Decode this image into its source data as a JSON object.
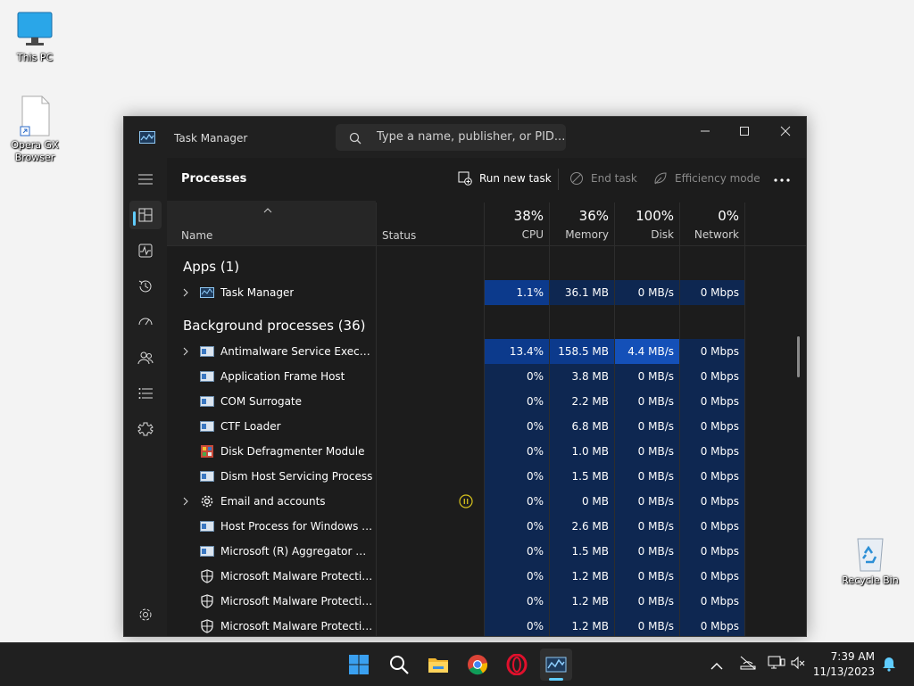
{
  "desktop": {
    "icons": [
      {
        "label": "This PC"
      },
      {
        "label": "Opera GX Browser"
      },
      {
        "label": "Recycle Bin"
      }
    ]
  },
  "window": {
    "title": "Task Manager",
    "search_placeholder": "Type a name, publisher, or PID...",
    "controls": {
      "minimize": "—",
      "maximize": "☐",
      "close": "✕"
    }
  },
  "sidebar": {
    "items": [
      {
        "name": "menu",
        "icon": "hamburger-icon"
      },
      {
        "name": "processes",
        "icon": "processes-icon",
        "selected": true
      },
      {
        "name": "performance",
        "icon": "performance-icon"
      },
      {
        "name": "app-history",
        "icon": "history-icon"
      },
      {
        "name": "startup-apps",
        "icon": "startup-icon"
      },
      {
        "name": "users",
        "icon": "users-icon"
      },
      {
        "name": "details",
        "icon": "details-icon"
      },
      {
        "name": "services",
        "icon": "services-icon"
      },
      {
        "name": "settings",
        "icon": "gear-icon"
      }
    ]
  },
  "toolbar": {
    "page_title": "Processes",
    "run_new_task": "Run new task",
    "end_task": "End task",
    "efficiency_mode": "Efficiency mode",
    "more": "•••"
  },
  "columns": {
    "name": "Name",
    "status": "Status",
    "cpu": {
      "pct": "38%",
      "label": "CPU"
    },
    "memory": {
      "pct": "36%",
      "label": "Memory"
    },
    "disk": {
      "pct": "100%",
      "label": "Disk"
    },
    "network": {
      "pct": "0%",
      "label": "Network"
    }
  },
  "groups": {
    "apps": "Apps (1)",
    "background": "Background processes (36)"
  },
  "processes": [
    {
      "name": "Task Manager",
      "cpu": "1.1%",
      "memory": "36.1 MB",
      "disk": "0 MB/s",
      "network": "0 Mbps",
      "expandable": true,
      "icon": "taskmanager-icon"
    },
    {
      "name": "Antimalware Service Executable",
      "cpu": "13.4%",
      "memory": "158.5 MB",
      "disk": "4.4 MB/s",
      "network": "0 Mbps",
      "expandable": true,
      "icon": "service-icon"
    },
    {
      "name": "Application Frame Host",
      "cpu": "0%",
      "memory": "3.8 MB",
      "disk": "0 MB/s",
      "network": "0 Mbps",
      "icon": "service-icon"
    },
    {
      "name": "COM Surrogate",
      "cpu": "0%",
      "memory": "2.2 MB",
      "disk": "0 MB/s",
      "network": "0 Mbps",
      "icon": "service-icon"
    },
    {
      "name": "CTF Loader",
      "cpu": "0%",
      "memory": "6.8 MB",
      "disk": "0 MB/s",
      "network": "0 Mbps",
      "icon": "service-icon"
    },
    {
      "name": "Disk Defragmenter Module",
      "cpu": "0%",
      "memory": "1.0 MB",
      "disk": "0 MB/s",
      "network": "0 Mbps",
      "icon": "defrag-icon"
    },
    {
      "name": "Dism Host Servicing Process",
      "cpu": "0%",
      "memory": "1.5 MB",
      "disk": "0 MB/s",
      "network": "0 Mbps",
      "icon": "service-icon"
    },
    {
      "name": "Email and accounts",
      "cpu": "0%",
      "memory": "0 MB",
      "disk": "0 MB/s",
      "network": "0 Mbps",
      "expandable": true,
      "icon": "gear-icon",
      "status": "suspended"
    },
    {
      "name": "Host Process for Windows Tasks",
      "cpu": "0%",
      "memory": "2.6 MB",
      "disk": "0 MB/s",
      "network": "0 Mbps",
      "icon": "service-icon"
    },
    {
      "name": "Microsoft (R) Aggregator Host",
      "cpu": "0%",
      "memory": "1.5 MB",
      "disk": "0 MB/s",
      "network": "0 Mbps",
      "icon": "service-icon"
    },
    {
      "name": "Microsoft Malware Protection ...",
      "cpu": "0%",
      "memory": "1.2 MB",
      "disk": "0 MB/s",
      "network": "0 Mbps",
      "icon": "shield-icon"
    },
    {
      "name": "Microsoft Malware Protection ...",
      "cpu": "0%",
      "memory": "1.2 MB",
      "disk": "0 MB/s",
      "network": "0 Mbps",
      "icon": "shield-icon"
    },
    {
      "name": "Microsoft Malware Protection ...",
      "cpu": "0%",
      "memory": "1.2 MB",
      "disk": "0 MB/s",
      "network": "0 Mbps",
      "icon": "shield-icon"
    }
  ],
  "taskbar": {
    "apps": [
      "start-icon",
      "search-icon",
      "file-explorer-icon",
      "chrome-icon",
      "opera-icon",
      "task-manager-icon"
    ],
    "clock_time": "7:39 AM",
    "clock_date": "11/13/2023"
  },
  "colors": {
    "accent": "#60cdff",
    "heat_low": "#0e2751",
    "heat_mid": "#0c3a8c",
    "heat_high": "#1450b8"
  }
}
